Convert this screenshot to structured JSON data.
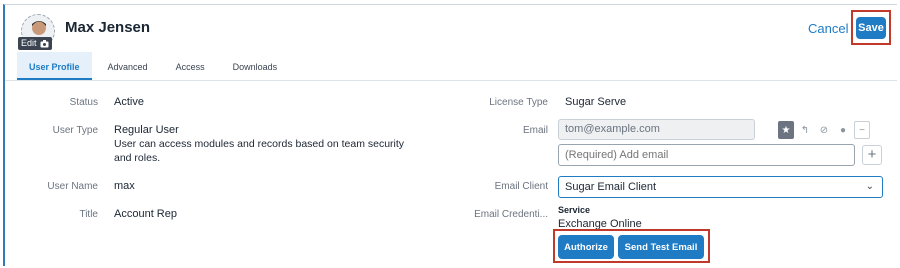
{
  "header": {
    "user_name": "Max Jensen",
    "edit_label": "Edit",
    "cancel_label": "Cancel",
    "save_label": "Save"
  },
  "tabs": [
    {
      "label": "User Profile",
      "active": true
    },
    {
      "label": "Advanced",
      "active": false
    },
    {
      "label": "Access",
      "active": false
    },
    {
      "label": "Downloads",
      "active": false
    }
  ],
  "fields": {
    "status": {
      "label": "Status",
      "value": "Active"
    },
    "user_type": {
      "label": "User Type",
      "value": "Regular User",
      "help": "User can access modules and records based on team security and roles."
    },
    "user_name": {
      "label": "User Name",
      "value": "max"
    },
    "title": {
      "label": "Title",
      "value": "Account Rep"
    },
    "license_type": {
      "label": "License Type",
      "value": "Sugar Serve"
    },
    "email": {
      "label": "Email",
      "value": "tom@example.com",
      "placeholder": "(Required) Add email"
    },
    "email_client": {
      "label": "Email Client",
      "value": "Sugar Email Client"
    },
    "email_credentials": {
      "label": "Email Credenti...",
      "service_heading": "Service",
      "service_value": "Exchange Online",
      "authorize_label": "Authorize",
      "send_test_label": "Send Test Email"
    }
  },
  "icons": {
    "email_actions": [
      "star-icon",
      "reply-icon",
      "opt-out-icon",
      "invalid-icon",
      "remove-icon"
    ],
    "add": "plus-icon",
    "select": "chevron-down-icon"
  },
  "colors": {
    "accent": "#1e7bc4",
    "highlight": "#c0392b",
    "active_tab_bg": "#e6f0fa"
  }
}
